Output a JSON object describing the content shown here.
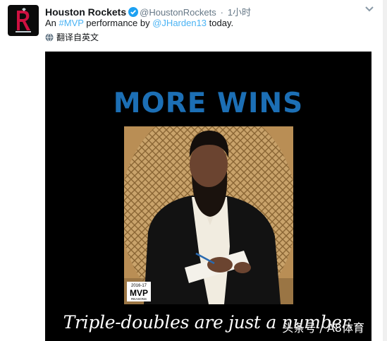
{
  "tweet": {
    "author_name": "Houston Rockets",
    "handle": "@HoustonRockets",
    "separator": "·",
    "time": "1小时",
    "text_prefix": "An ",
    "hashtag": "#MVP",
    "text_middle": " performance by ",
    "mention": "@JHarden13",
    "text_suffix": " today.",
    "translate_label": "翻译自英文"
  },
  "media": {
    "headline": "MORE WINS",
    "badge_season": "2016-17",
    "badge_title": "MVP",
    "badge_sub": "REASONS",
    "caption": "Triple-doubles are just a number."
  },
  "watermark": "头条号 / A8体育",
  "colors": {
    "link": "#4ab3f4",
    "headline": "#1c6fb5",
    "verified": "#1da1f2",
    "logo_red": "#ce1141"
  },
  "icons": {
    "avatar": "rockets-logo-icon",
    "verified": "verified-badge-icon",
    "caret": "chevron-down-icon",
    "translate": "globe-icon"
  }
}
